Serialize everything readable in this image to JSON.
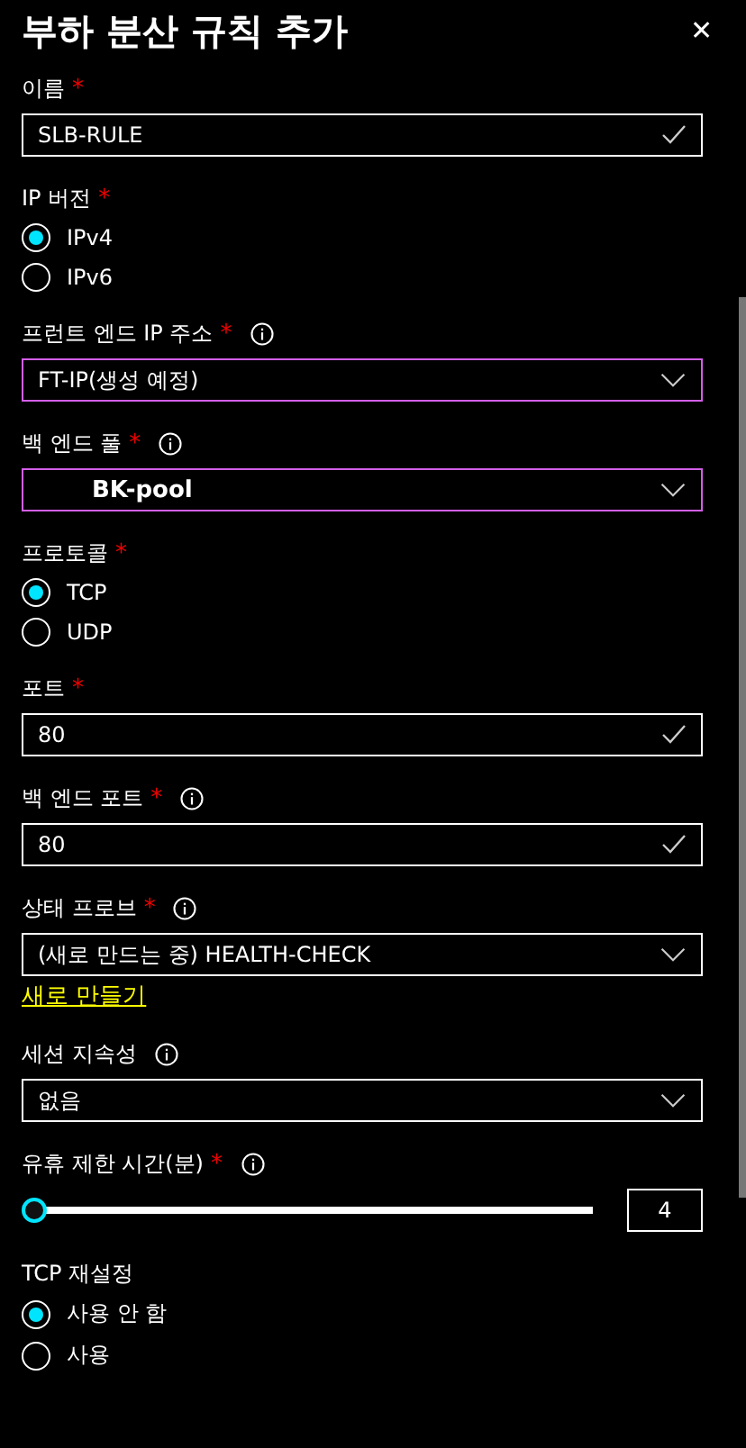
{
  "title": "부하 분산 규칙 추가",
  "close": "✕",
  "fields": [
    {
      "kind": "text",
      "label": "이름",
      "required_mark": "*",
      "info": false,
      "value": "SLB-RULE",
      "valid": true
    },
    {
      "kind": "radio",
      "label": "IP 버전",
      "required_mark": "*",
      "info": false,
      "options": [
        {
          "label": "IPv4",
          "selected": true
        },
        {
          "label": "IPv6",
          "selected": false
        }
      ]
    },
    {
      "kind": "dropdown",
      "label": "프런트 엔드 IP 주소",
      "required_mark": "*",
      "info": true,
      "value": "FT-IP(생성 예정)",
      "focused": true,
      "emphasized": false
    },
    {
      "kind": "dropdown",
      "label": "백 엔드 풀",
      "required_mark": "*",
      "info": true,
      "value": "BK-pool",
      "focused": true,
      "emphasized": true
    },
    {
      "kind": "radio",
      "label": "프로토콜",
      "required_mark": "*",
      "info": false,
      "options": [
        {
          "label": "TCP",
          "selected": true
        },
        {
          "label": "UDP",
          "selected": false
        }
      ]
    },
    {
      "kind": "text",
      "label": "포트",
      "required_mark": "*",
      "info": false,
      "value": "80",
      "valid": true
    },
    {
      "kind": "text",
      "label": "백 엔드 포트",
      "required_mark": "*",
      "info": true,
      "value": "80",
      "valid": true
    },
    {
      "kind": "dropdown",
      "label": "상태 프로브",
      "required_mark": "*",
      "info": true,
      "value": "(새로 만드는 중) HEALTH-CHECK",
      "focused": false,
      "emphasized": false,
      "link": "새로 만들기"
    },
    {
      "kind": "dropdown",
      "label": "세션 지속성",
      "info": true,
      "value": "없음",
      "focused": false,
      "emphasized": false
    },
    {
      "kind": "slider",
      "label": "유휴 제한 시간(분)",
      "required_mark": "*",
      "info": true,
      "level": 0,
      "value": "4"
    },
    {
      "kind": "radio",
      "label": "TCP 재설정",
      "info": false,
      "options": [
        {
          "label": "사용 안 함",
          "selected": true
        },
        {
          "label": "사용",
          "selected": false
        }
      ]
    }
  ]
}
